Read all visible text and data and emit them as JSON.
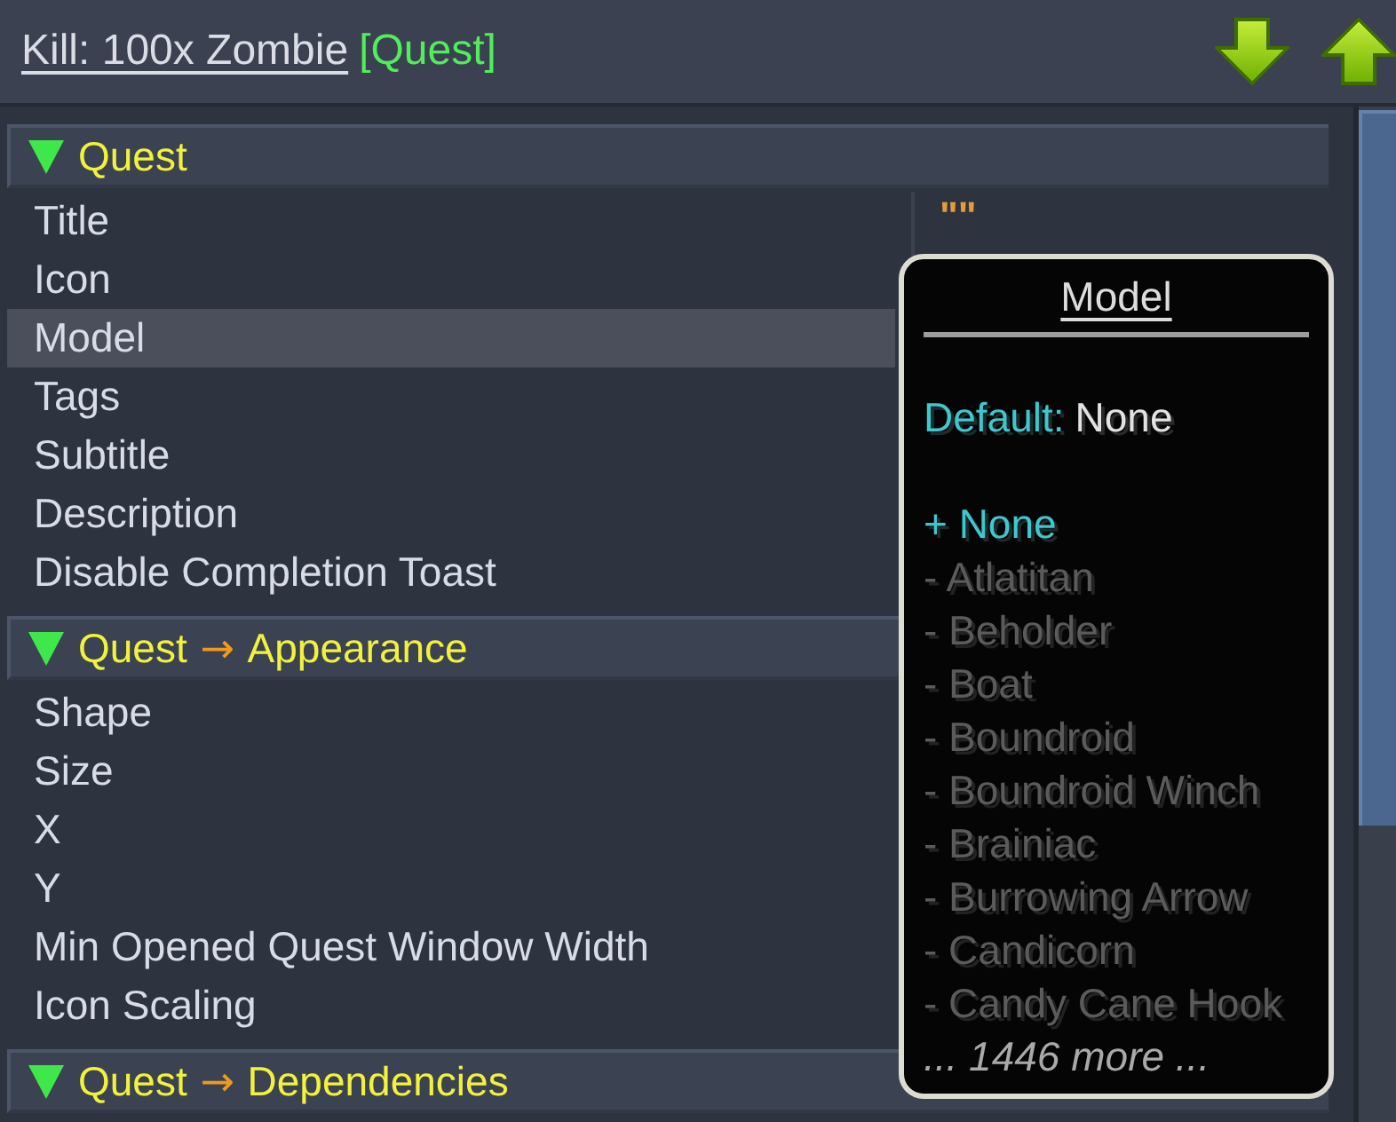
{
  "header": {
    "title": "Kill: 100x Zombie",
    "tag": "[Quest]"
  },
  "sections": [
    {
      "name": "Quest",
      "expanded": true,
      "rows": [
        {
          "label": "Title",
          "value": "\"\"",
          "selected": false
        },
        {
          "label": "Icon",
          "selected": false
        },
        {
          "label": "Model",
          "selected": true
        },
        {
          "label": "Tags",
          "selected": false
        },
        {
          "label": "Subtitle",
          "selected": false
        },
        {
          "label": "Description",
          "selected": false
        },
        {
          "label": "Disable Completion Toast",
          "selected": false
        }
      ]
    },
    {
      "parent": "Quest",
      "arrow": "→",
      "name": "Appearance",
      "expanded": true,
      "rows": [
        {
          "label": "Shape",
          "selected": false
        },
        {
          "label": "Size",
          "selected": false
        },
        {
          "label": "X",
          "selected": false
        },
        {
          "label": "Y",
          "selected": false
        },
        {
          "label": "Min Opened Quest Window Width",
          "selected": false
        },
        {
          "label": "Icon Scaling",
          "selected": false
        }
      ]
    },
    {
      "parent": "Quest",
      "arrow": "→",
      "name": "Dependencies",
      "expanded": true
    }
  ],
  "tooltip": {
    "title": "Model",
    "default_label": "Default:",
    "default_value": "None",
    "options": [
      {
        "label": "+ None",
        "selected": true
      },
      {
        "label": "- Atlatitan",
        "selected": false
      },
      {
        "label": "- Beholder",
        "selected": false
      },
      {
        "label": "- Boat",
        "selected": false
      },
      {
        "label": "- Boundroid",
        "selected": false
      },
      {
        "label": "- Boundroid Winch",
        "selected": false
      },
      {
        "label": "- Brainiac",
        "selected": false
      },
      {
        "label": "- Burrowing Arrow",
        "selected": false
      },
      {
        "label": "- Candicorn",
        "selected": false
      },
      {
        "label": "- Candy Cane Hook",
        "selected": false
      }
    ],
    "more": "... 1446 more ..."
  }
}
